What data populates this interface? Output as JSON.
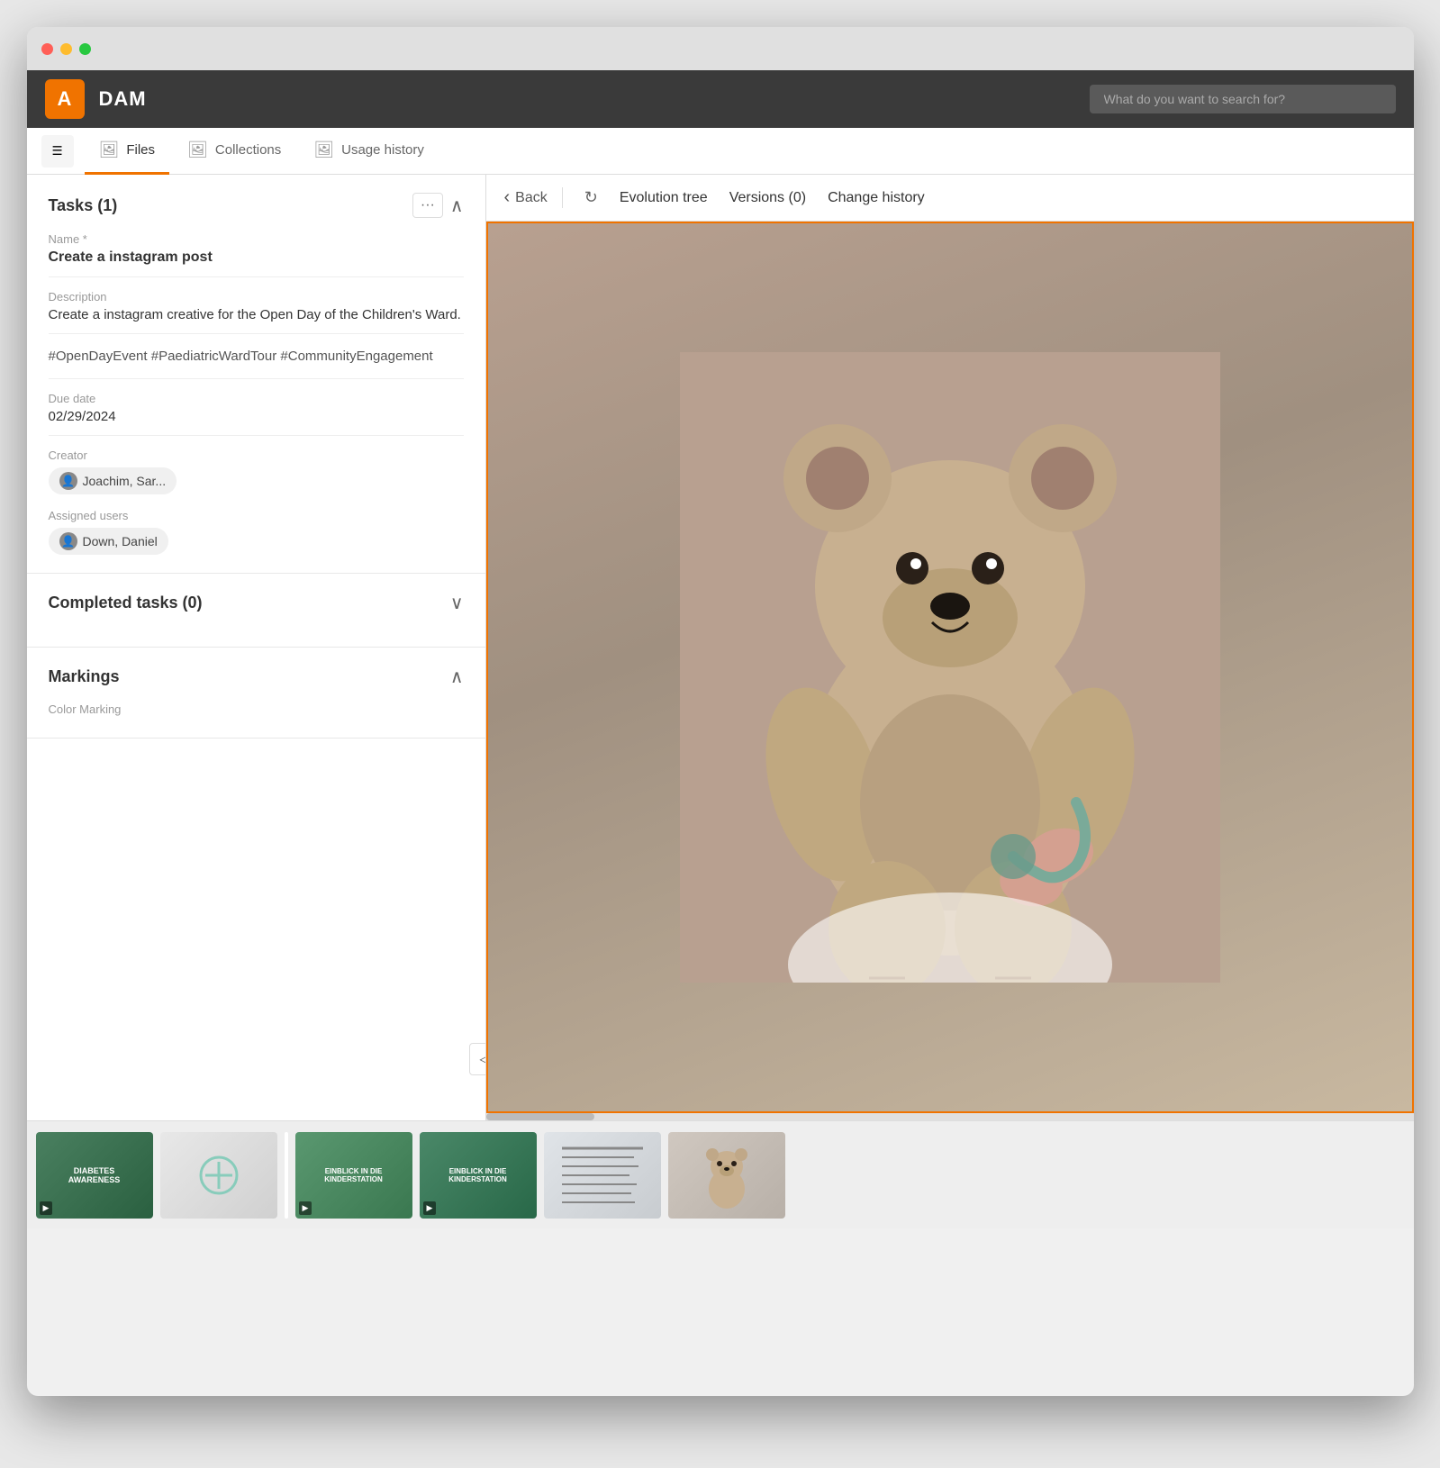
{
  "window": {
    "title": "DAM"
  },
  "header": {
    "logo_text": "A",
    "app_name": "DAM",
    "search_placeholder": "What do you want to search for?"
  },
  "tabs": [
    {
      "id": "files",
      "label": "Files",
      "active": true
    },
    {
      "id": "collections",
      "label": "Collections",
      "active": false
    },
    {
      "id": "usage_history",
      "label": "Usage history",
      "active": false
    }
  ],
  "left_panel": {
    "tasks_section": {
      "title": "Tasks (1)",
      "toggle": "^",
      "name_label": "Name *",
      "name_value": "Create a instagram post",
      "description_label": "Description",
      "description_value": "Create a instagram creative for the Open Day of the Children's Ward.",
      "tags_value": "#OpenDayEvent #PaediatricWardTour #CommunityEngagement",
      "due_date_label": "Due date",
      "due_date_value": "02/29/2024",
      "creator_label": "Creator",
      "creator_value": "Joachim, Sar...",
      "assigned_users_label": "Assigned users",
      "assigned_users_value": "Down, Daniel"
    },
    "completed_tasks_section": {
      "title": "Completed tasks (0)",
      "toggle": "v"
    },
    "markings_section": {
      "title": "Markings",
      "toggle": "^",
      "color_marking_label": "Color Marking"
    }
  },
  "right_panel": {
    "back_label": "Back",
    "evolution_tree_label": "Evolution tree",
    "versions_label": "Versions (0)",
    "change_history_label": "Change history"
  },
  "filmstrip": {
    "items": [
      {
        "id": 1,
        "label": "DIABETES\nAWARENESS",
        "color_class": "film-item-1"
      },
      {
        "id": 2,
        "label": "",
        "color_class": "film-item-2"
      },
      {
        "id": 3,
        "label": "EINBLICK IN DIE\nKINDERSTATION",
        "color_class": "film-item-3"
      },
      {
        "id": 4,
        "label": "EINBLICK IN DIE\nKINDERSTATION",
        "color_class": "film-item-4"
      },
      {
        "id": 5,
        "label": "",
        "color_class": "film-item-5"
      },
      {
        "id": 6,
        "label": "",
        "color_class": "film-item-6"
      }
    ]
  },
  "icons": {
    "chevron_up": "∧",
    "chevron_down": "∨",
    "chevron_left": "‹",
    "refresh": "↻",
    "menu": "☰",
    "more": "···",
    "collapse": "◁",
    "user": "👤"
  },
  "colors": {
    "accent": "#f07300",
    "header_bg": "#3a3a3a",
    "tab_active_border": "#f07300"
  }
}
